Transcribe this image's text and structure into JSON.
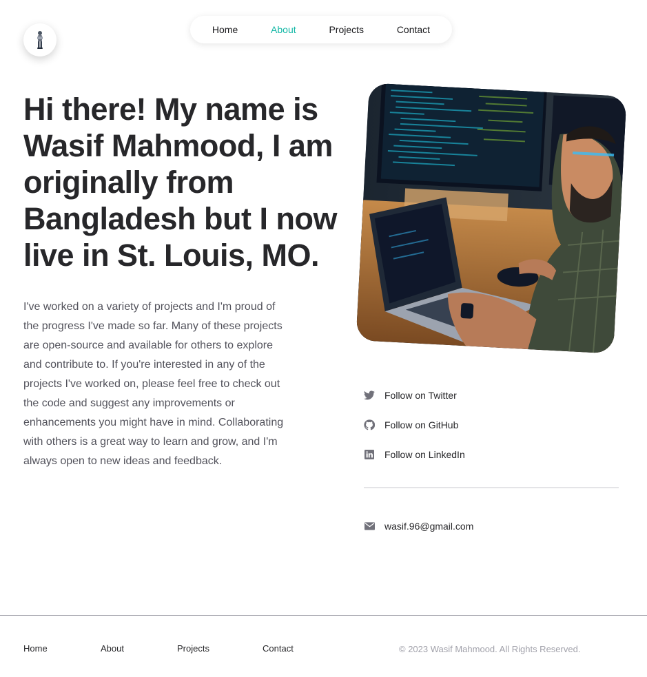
{
  "header": {
    "avatar_icon": "avatar-icon",
    "nav": [
      {
        "label": "Home",
        "active": false
      },
      {
        "label": "About",
        "active": true
      },
      {
        "label": "Projects",
        "active": false
      },
      {
        "label": "Contact",
        "active": false
      }
    ],
    "active_color": "#14b8a6"
  },
  "main": {
    "heading": "Hi there! My name is Wasif Mahmood, I am originally from Bangladesh but I now live in St. Louis, MO.",
    "intro": "I've worked on a variety of projects and I'm proud of the progress I've made so far. Many of these projects are open-source and available for others to explore and contribute to. If you're interested in any of the projects I've worked on, please feel free to check out the code and suggest any improvements or enhancements you might have in mind. Collaborating with others is a great way to learn and grow, and I'm always open to new ideas and feedback.",
    "photo_icon": "developer-photo"
  },
  "socials": [
    {
      "label": "Follow on Twitter",
      "icon": "twitter-icon"
    },
    {
      "label": "Follow on GitHub",
      "icon": "github-icon"
    },
    {
      "label": "Follow on LinkedIn",
      "icon": "linkedin-icon"
    }
  ],
  "contact": {
    "email": "wasif.96@gmail.com",
    "icon": "mail-icon"
  },
  "footer": {
    "nav": [
      {
        "label": "Home"
      },
      {
        "label": "About"
      },
      {
        "label": "Projects"
      },
      {
        "label": "Contact"
      }
    ],
    "copyright": "© 2023 Wasif Mahmood. All Rights Reserved."
  }
}
